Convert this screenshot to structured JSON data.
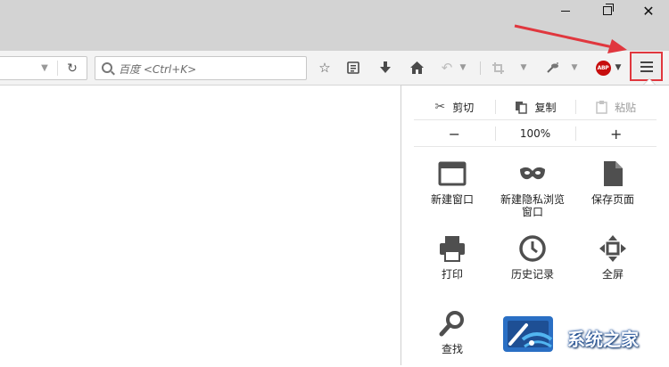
{
  "titlebar": {
    "controls": [
      "minimize-icon",
      "restore-icon",
      "close-icon"
    ]
  },
  "toolbar": {
    "search_placeholder": "百度 <Ctrl+K>",
    "buttons": [
      "star-icon",
      "reading-list-icon",
      "download-icon",
      "home-icon",
      "undo-icon",
      "crop-icon",
      "dropper-icon"
    ],
    "abp_label": "ABP",
    "menu_icon": "hamburger-icon"
  },
  "menu_panel": {
    "edit_row": {
      "cut": "剪切",
      "copy": "复制",
      "paste": "粘贴"
    },
    "zoom_row": {
      "minus": "−",
      "level": "100%",
      "plus": "+"
    },
    "items": [
      {
        "label": "新建窗口",
        "icon": "window-icon"
      },
      {
        "label": "新建隐私浏览窗口",
        "icon": "mask-icon"
      },
      {
        "label": "保存页面",
        "icon": "page-icon"
      },
      {
        "label": "打印",
        "icon": "printer-icon"
      },
      {
        "label": "历史记录",
        "icon": "clock-icon"
      },
      {
        "label": "全屏",
        "icon": "fullscreen-icon"
      },
      {
        "label": "查找",
        "icon": "magnifier-icon"
      }
    ]
  },
  "annotation": {
    "color": "#e0373e"
  },
  "watermark": {
    "text": "系统之家"
  }
}
